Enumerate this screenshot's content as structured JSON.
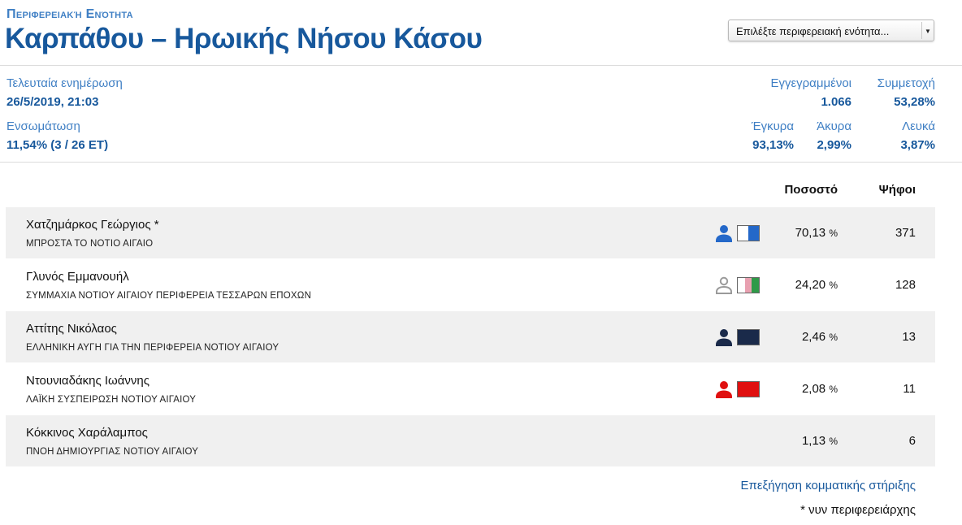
{
  "header": {
    "kicker": "Περιφερειακή Ενότητα",
    "title": "Καρπάθου – Ηρωικής Νήσου Κάσου",
    "select_placeholder": "Επιλέξτε περιφερειακή ενότητα..."
  },
  "stats": {
    "last_update_label": "Τελευταία ενημέρωση",
    "last_update_value": "26/5/2019, 21:03",
    "incorporation_label": "Ενσωμάτωση",
    "incorporation_value": "11,54% (3 / 26 ΕΤ)",
    "registered_label": "Εγγεγραμμένοι",
    "registered_value": "1.066",
    "turnout_label": "Συμμετοχή",
    "turnout_value": "53,28%",
    "valid_label": "Έγκυρα",
    "valid_value": "93,13%",
    "invalid_label": "Άκυρα",
    "invalid_value": "2,99%",
    "blank_label": "Λευκά",
    "blank_value": "3,87%"
  },
  "table": {
    "col_percent": "Ποσοστό",
    "col_votes": "Ψήφοι",
    "percent_sign": "%",
    "rows": [
      {
        "name": "Χατζημάρκος Γεώργιος *",
        "party": "ΜΠΡΟΣΤΑ ΤΟ ΝΟΤΙΟ ΑΙΓΑΙΟ",
        "percent": "70,13",
        "votes": "371",
        "icon_color": "#2468c9",
        "icon_style": "filled",
        "swatch": [
          "#ffffff",
          "#2468c9"
        ]
      },
      {
        "name": "Γλυνός Εμμανουήλ",
        "party": "ΣΥΜΜΑΧΙΑ ΝΟΤΙΟΥ ΑΙΓΑΙΟΥ ΠΕΡΙΦΕΡΕΙΑ ΤΕΣΣΑΡΩΝ ΕΠΟΧΩΝ",
        "percent": "24,20",
        "votes": "128",
        "icon_color": "#9a9a9a",
        "icon_style": "outline",
        "swatch": [
          "#ffffff",
          "#e8a0b0",
          "#2f9a48"
        ]
      },
      {
        "name": "Αττίτης Νικόλαος",
        "party": "ΕΛΛΗΝΙΚΗ ΑΥΓΗ ΓΙΑ ΤΗΝ ΠΕΡΙΦΕΡΕΙΑ ΝΟΤΙΟΥ ΑΙΓΑΙΟΥ",
        "percent": "2,46",
        "votes": "13",
        "icon_color": "#1a2a4a",
        "icon_style": "filled",
        "swatch": [
          "#1a2a4a"
        ]
      },
      {
        "name": "Ντουνιαδάκης Ιωάννης",
        "party": "ΛΑΪΚΗ ΣΥΣΠΕΙΡΩΣΗ ΝΟΤΙΟΥ ΑΙΓΑΙΟΥ",
        "percent": "2,08",
        "votes": "11",
        "icon_color": "#e01010",
        "icon_style": "filled",
        "swatch": [
          "#e01010"
        ]
      },
      {
        "name": "Κόκκινος Χαράλαμπος",
        "party": "ΠΝΟΗ ΔΗΜΙΟΥΡΓΙΑΣ ΝΟΤΙΟΥ ΑΙΓΑΙΟΥ",
        "percent": "1,13",
        "votes": "6",
        "icon_color": "",
        "icon_style": "none",
        "swatch": []
      }
    ]
  },
  "footer": {
    "link": "Επεξήγηση κομματικής στήριξης",
    "note": "* νυν περιφερειάρχης"
  }
}
